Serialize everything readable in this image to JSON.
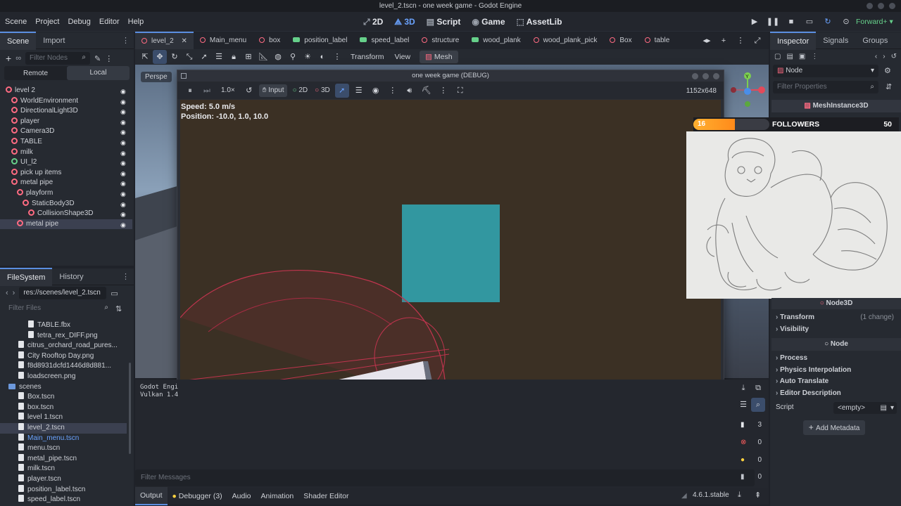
{
  "window_title": "level_2.tscn - one week game - Godot Engine",
  "menu": [
    "Scene",
    "Project",
    "Debug",
    "Editor",
    "Help"
  ],
  "workspaces": [
    {
      "label": "2D"
    },
    {
      "label": "3D"
    },
    {
      "label": "Script"
    },
    {
      "label": "Game"
    },
    {
      "label": "AssetLib"
    }
  ],
  "renderer": "Forward+",
  "scene_dock": {
    "tabs": [
      "Scene",
      "Import"
    ],
    "filter_placeholder": "Filter Nodes",
    "remote": "Remote",
    "local": "Local"
  },
  "scene_tree": [
    {
      "label": "level 2",
      "indent": 0,
      "color": "#ff6b82"
    },
    {
      "label": "WorldEnvironment",
      "indent": 1,
      "color": "#ff6b82"
    },
    {
      "label": "DirectionalLight3D",
      "indent": 1,
      "color": "#ff6b82"
    },
    {
      "label": "player",
      "indent": 1,
      "color": "#ff6b82"
    },
    {
      "label": "Camera3D",
      "indent": 1,
      "color": "#ff6b82"
    },
    {
      "label": "TABLE",
      "indent": 1,
      "color": "#ff6b82"
    },
    {
      "label": "milk",
      "indent": 1,
      "color": "#ff6b82"
    },
    {
      "label": "UI_l2",
      "indent": 1,
      "color": "#66d08a"
    },
    {
      "label": "pick up items",
      "indent": 1,
      "color": "#ff6b82"
    },
    {
      "label": "metal pipe",
      "indent": 1,
      "color": "#ff6b82"
    },
    {
      "label": "playform",
      "indent": 2,
      "color": "#ff6b82"
    },
    {
      "label": "StaticBody3D",
      "indent": 3,
      "color": "#ff6b82"
    },
    {
      "label": "CollisionShape3D",
      "indent": 4,
      "color": "#ff6b82"
    },
    {
      "label": "metal pipe",
      "indent": 2,
      "color": "#ff6b82",
      "selected": true
    }
  ],
  "filesystem": {
    "tabs": [
      "FileSystem",
      "History"
    ],
    "path": "res://scenes/level_2.tscn",
    "filter_placeholder": "Filter Files",
    "items": [
      {
        "label": "TABLE.fbx",
        "indent": 2,
        "type": "file"
      },
      {
        "label": "tetra_rex_DIFF.png",
        "indent": 2,
        "type": "file"
      },
      {
        "label": "citrus_orchard_road_pures...",
        "indent": 1,
        "type": "file"
      },
      {
        "label": "City Rooftop Day.png",
        "indent": 1,
        "type": "file"
      },
      {
        "label": "f8d8931dcfd1446d8d881...",
        "indent": 1,
        "type": "file"
      },
      {
        "label": "loadscreen.png",
        "indent": 1,
        "type": "file"
      },
      {
        "label": "scenes",
        "indent": 0,
        "type": "folder"
      },
      {
        "label": "Box.tscn",
        "indent": 1,
        "type": "file"
      },
      {
        "label": "box.tscn",
        "indent": 1,
        "type": "file"
      },
      {
        "label": "level 1.tscn",
        "indent": 1,
        "type": "file"
      },
      {
        "label": "level_2.tscn",
        "indent": 1,
        "type": "file",
        "selected": true
      },
      {
        "label": "Main_menu.tscn",
        "indent": 1,
        "type": "file",
        "link": true
      },
      {
        "label": "menu.tscn",
        "indent": 1,
        "type": "file"
      },
      {
        "label": "metal_pipe.tscn",
        "indent": 1,
        "type": "file"
      },
      {
        "label": "milk.tscn",
        "indent": 1,
        "type": "file"
      },
      {
        "label": "player.tscn",
        "indent": 1,
        "type": "file"
      },
      {
        "label": "position_label.tscn",
        "indent": 1,
        "type": "file"
      },
      {
        "label": "speed_label.tscn",
        "indent": 1,
        "type": "file"
      }
    ]
  },
  "scene_tabs": [
    {
      "label": "level_2",
      "kind": "ring"
    },
    {
      "label": "Main_menu",
      "kind": "ring"
    },
    {
      "label": "box",
      "kind": "ring"
    },
    {
      "label": "position_label",
      "kind": "green"
    },
    {
      "label": "speed_label",
      "kind": "green"
    },
    {
      "label": "structure",
      "kind": "ring"
    },
    {
      "label": "wood_plank",
      "kind": "green"
    },
    {
      "label": "wood_plank_pick",
      "kind": "ring"
    },
    {
      "label": "Box",
      "kind": "ring"
    },
    {
      "label": "table",
      "kind": "ring"
    }
  ],
  "viewport_toolbar": {
    "transform": "Transform",
    "view": "View",
    "mesh": "Mesh",
    "perspective": "Perspe"
  },
  "game_window": {
    "title": "one week game (DEBUG)",
    "speed_btn": "1.0×",
    "input": "Input",
    "mode_2d": "2D",
    "mode_3d": "3D",
    "resolution": "1152x648",
    "speed_text": "Speed: 5.0 m/s",
    "position_text": "Position: -10.0, 1.0, 10.0"
  },
  "followers_overlay": {
    "count_left": "16",
    "label": "FOLLOWERS",
    "count_right": "50",
    "fill": 0.55
  },
  "inspector": {
    "tabs": [
      "Inspector",
      "Signals",
      "Groups"
    ],
    "node": "Node",
    "filter_placeholder": "Filter Properties",
    "class_header": "MeshInstance3D",
    "node3d": "Node3D",
    "transform": "Transform",
    "transform_change": "(1 change)",
    "visibility": "Visibility",
    "process": "Process",
    "physics_interpolation": "Physics Interpolation",
    "auto_translate": "Auto Translate",
    "editor_description": "Editor Description",
    "script_label": "Script",
    "script_value": "<empty>",
    "add_metadata": "Add Metadata"
  },
  "output": {
    "line1": "Godot Engi",
    "line2": "Vulkan 1.4",
    "filter_placeholder": "Filter Messages",
    "counts": [
      "3",
      "0",
      "0",
      "0"
    ]
  },
  "bottom_tabs": [
    "Output",
    "Debugger (3)",
    "Audio",
    "Animation",
    "Shader Editor"
  ],
  "version": "4.6.1.stable"
}
